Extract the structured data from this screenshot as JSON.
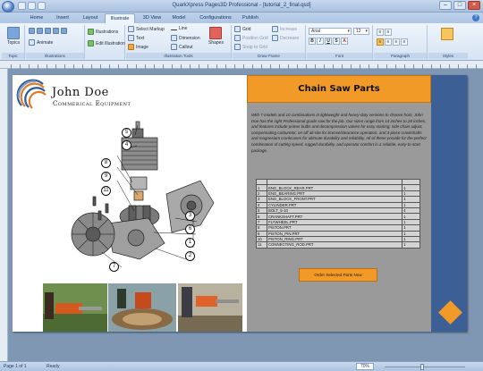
{
  "window": {
    "title": "QuarkXpress Pages3D Professional - [tutorial_2_final.qsd]"
  },
  "tabs": [
    "Home",
    "Insert",
    "Layout",
    "Illustrate",
    "3D View",
    "Model",
    "Configurations",
    "Publish"
  ],
  "active_tab": "Illustrate",
  "ribbon": {
    "topics": {
      "label": "Topics",
      "group": "Topic"
    },
    "nav": {
      "animate": "Animate",
      "group": "Illustrations"
    },
    "illustrations": {
      "illustrations": "Illustrations",
      "edit": "Edit Illustration"
    },
    "tools": {
      "select_markup": "Select Markup",
      "text": "Text",
      "image": "Image",
      "line": "Line",
      "dimension": "Dimension",
      "callout": "Callout",
      "shapes": "Shapes",
      "group": "Illustration Tools"
    },
    "draw": {
      "grid": "Grid",
      "position_grid": "Position Grid",
      "snap_to_grid": "Snap to Grid",
      "increase": "Increase",
      "decrease": "Decrease",
      "group": "Draw Frame"
    },
    "font": {
      "name": "Arial",
      "size": "12",
      "group": "Font"
    },
    "paragraph": {
      "group": "Paragraph"
    },
    "styles": {
      "group": "Styles"
    }
  },
  "document": {
    "company_name": "John Doe",
    "company_sub": "Commerical Equipment",
    "banner_title": "Chain Saw Parts",
    "description": "With 7 models and 10 combinations in lightweight and heavy-duty versions to choose from, John Doe has the right Professional grade saw for the job. Our sizes range from 14 inches to 28 inches, and features include primer bulbs and decompression valves for easy starting, side chain adjust, compensating carburetor, on-off all-site for license/clearance operation, and 3-piece crankshafts and magnesium crankcases for ultimate durability and reliability. All of these provide for the perfect combination of cutting speed, rugged durability, and operator comfort in a reliable, easy-to-start package.",
    "callouts": [
      "5",
      "4",
      "8",
      "9",
      "11",
      "3",
      "6",
      "1",
      "2",
      "7"
    ],
    "parts_table": [
      [
        "1",
        "ENG_BLOCK_REAR.PRT",
        "1"
      ],
      [
        "2",
        "ENG_BEARING.PRT",
        "1"
      ],
      [
        "3",
        "ENG_BLOCK_FRONT.PRT",
        "1"
      ],
      [
        "4",
        "CYLINDER.PRT",
        "1"
      ],
      [
        "5",
        "BOLT_5-10",
        "4"
      ],
      [
        "6",
        "CRANKSHAFT.PRT",
        "1"
      ],
      [
        "7",
        "FLYWHEEL.PRT",
        "1"
      ],
      [
        "8",
        "PISTON.PRT",
        "1"
      ],
      [
        "9",
        "PISTON_PIN.PRT",
        "1"
      ],
      [
        "10",
        "PISTON_RING.PRT",
        "1"
      ],
      [
        "11",
        "CONNECTING_ROD.PRT",
        "1"
      ]
    ],
    "order_button": "Order Selected Parts Now"
  },
  "status": {
    "page": "Page 1 of 1",
    "state": "Ready",
    "zoom": "70%"
  },
  "colors": {
    "accent_orange": "#f29a27",
    "stripe_blue": "#3c5f96",
    "panel_gray": "#9a9a9a"
  }
}
